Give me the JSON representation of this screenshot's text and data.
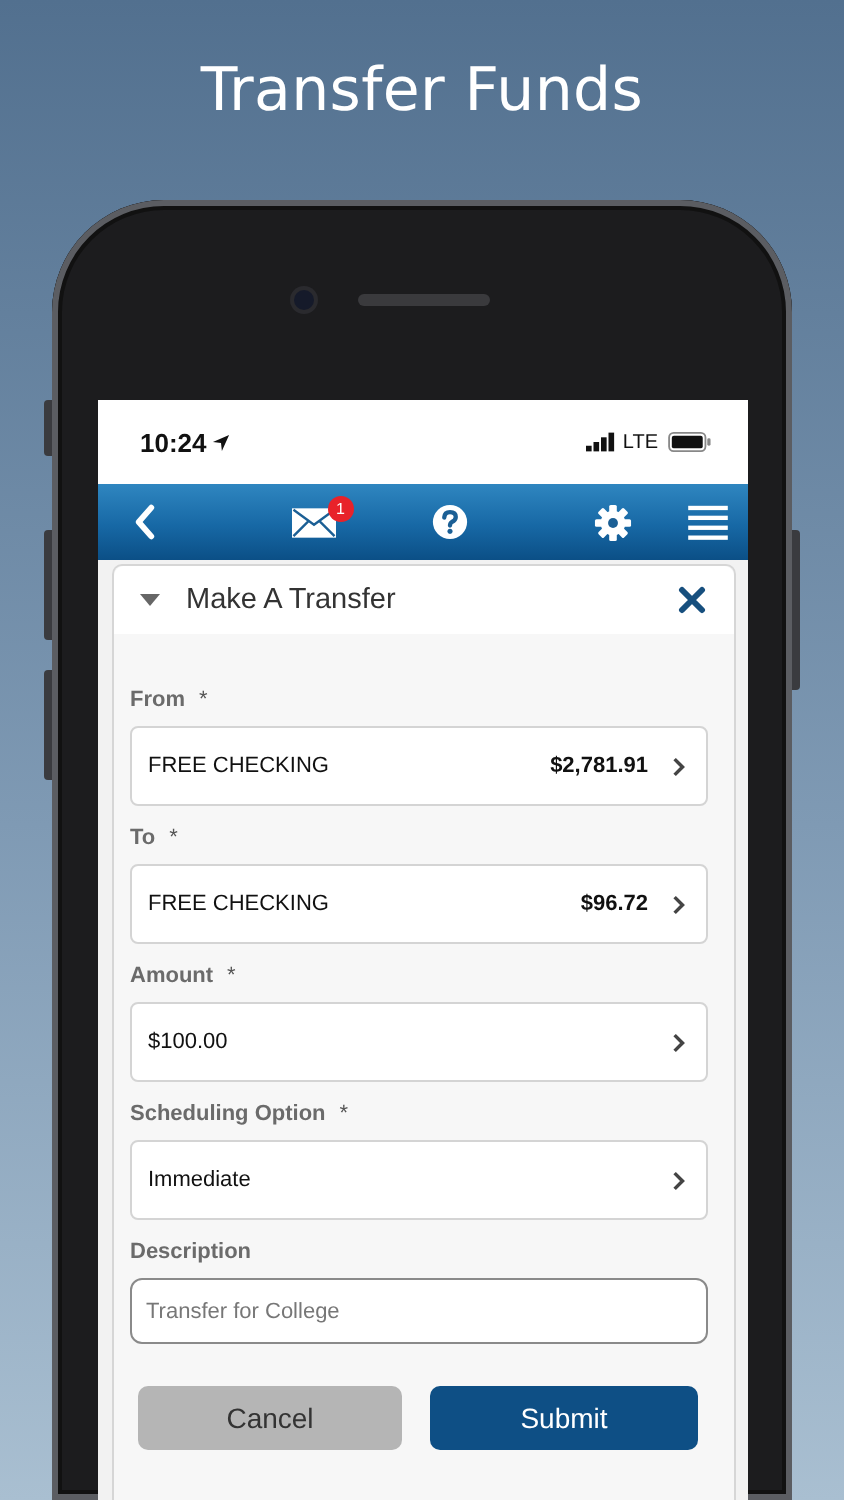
{
  "headline": "Transfer Funds",
  "status_bar": {
    "time": "10:24",
    "network": "LTE"
  },
  "nav": {
    "mail_badge": "1"
  },
  "panel": {
    "title": "Make A Transfer",
    "expanded": true
  },
  "fields": [
    {
      "kind": "select",
      "label": "From",
      "required_mark": "*",
      "value": "FREE CHECKING",
      "amount": "$2,781.91"
    },
    {
      "kind": "select",
      "label": "To",
      "required_mark": "*",
      "value": "FREE CHECKING",
      "amount": "$96.72"
    },
    {
      "kind": "select",
      "label": "Amount",
      "required_mark": "*",
      "value": "$100.00"
    },
    {
      "kind": "select",
      "label": "Scheduling Option",
      "required_mark": "*",
      "value": "Immediate"
    },
    {
      "kind": "text",
      "label": "Description",
      "placeholder": "Transfer for College"
    }
  ],
  "buttons": [
    {
      "label": "Cancel",
      "kind": "secondary"
    },
    {
      "label": "Submit",
      "kind": "primary"
    }
  ]
}
